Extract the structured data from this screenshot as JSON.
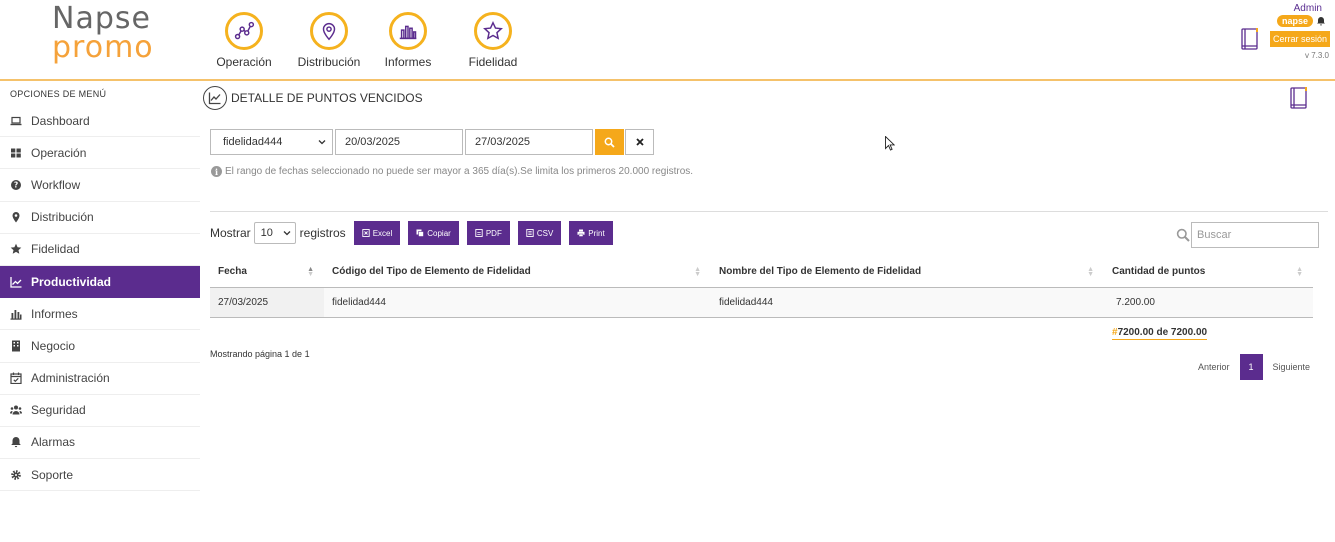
{
  "brand": {
    "line1": "Napse",
    "line2": "promo"
  },
  "topnav": [
    {
      "label": "Operación",
      "icon": "route-graph-icon"
    },
    {
      "label": "Distribución",
      "icon": "map-pin-icon"
    },
    {
      "label": "Informes",
      "icon": "bar-chart-icon"
    },
    {
      "label": "Fidelidad",
      "icon": "star-icon"
    }
  ],
  "user": {
    "name": "Admin",
    "badge": "napse",
    "logout": "Cerrar sesión",
    "version": "v 7.3.0"
  },
  "sidebar": {
    "title": "OPCIONES DE MENÚ",
    "items": [
      {
        "label": "Dashboard",
        "icon": "laptop-icon"
      },
      {
        "label": "Operación",
        "icon": "grid-icon"
      },
      {
        "label": "Workflow",
        "icon": "question-circle-icon"
      },
      {
        "label": "Distribución",
        "icon": "map-marker-icon"
      },
      {
        "label": "Fidelidad",
        "icon": "star-icon"
      },
      {
        "label": "Productividad",
        "icon": "line-chart-icon",
        "active": true
      },
      {
        "label": "Informes",
        "icon": "bar-chart-icon"
      },
      {
        "label": "Negocio",
        "icon": "building-icon"
      },
      {
        "label": "Administración",
        "icon": "calendar-check-icon"
      },
      {
        "label": "Seguridad",
        "icon": "users-icon"
      },
      {
        "label": "Alarmas",
        "icon": "bell-icon"
      },
      {
        "label": "Soporte",
        "icon": "gear-icon"
      }
    ]
  },
  "page": {
    "title": "DETALLE DE PUNTOS VENCIDOS"
  },
  "filters": {
    "type_selected": "fidelidad444",
    "date_from": "20/03/2025",
    "date_to": "27/03/2025",
    "hint": "El rango de fechas seleccionado no puede ser mayor a 365 día(s).Se limita los primeros 20.000 registros."
  },
  "toolbar": {
    "show_label": "Mostrar",
    "page_length": "10",
    "records_label": "registros",
    "buttons": [
      "Excel",
      "Copiar",
      "PDF",
      "CSV",
      "Print"
    ],
    "search_placeholder": "Buscar"
  },
  "table": {
    "columns": [
      "Fecha",
      "Código del Tipo de Elemento de Fidelidad",
      "Nombre del Tipo de Elemento de Fidelidad",
      "Cantidad de puntos"
    ],
    "rows": [
      [
        "27/03/2025",
        "fidelidad444",
        "fidelidad444",
        "7.200.00"
      ]
    ],
    "total_hash": "#",
    "total": "7200.00 de 7200.00"
  },
  "pagination": {
    "info": "Mostrando página 1 de 1",
    "prev": "Anterior",
    "current": "1",
    "next": "Siguiente"
  },
  "colors": {
    "accent_orange": "#f5a81a",
    "accent_purple": "#5b2c8e"
  }
}
